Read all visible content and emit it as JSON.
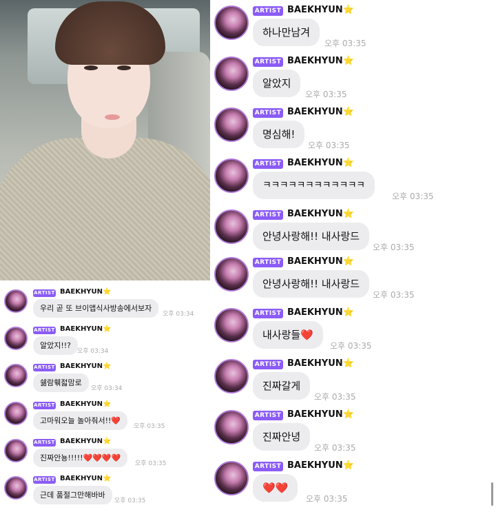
{
  "photo": {
    "alt": "selfie"
  },
  "artist_badge": "ARTIST",
  "artist_name": "BAEKHYUN",
  "star": "⭐",
  "left_messages": [
    {
      "text": "우리 곧 또 브이앱식사방송에서보자",
      "time": "오후 03:34"
    },
    {
      "text": "알았지!!?",
      "time": "오후 03:34"
    },
    {
      "text": "쉚람훾젋맘로",
      "time": "오후 03:34"
    },
    {
      "text": "고마워오늘 놀아줘서!!",
      "heart": "❤️",
      "time": "오후 03:35"
    },
    {
      "text": "진짜안뇽!!!!!",
      "heart": "❤️❤️❤️❤️",
      "time": "오후 03:35"
    },
    {
      "text": "근데 품절그만해바바",
      "time": "오후 03:35"
    }
  ],
  "right_messages": [
    {
      "text": "하나만남겨",
      "time": "오후 03:35"
    },
    {
      "text": "알았지",
      "time": "오후 03:35"
    },
    {
      "text": "명심해!",
      "time": "오후 03:35"
    },
    {
      "text": "ㅋㅋㅋㅋㅋㅋㅋㅋㅋㅋㅋㅋ",
      "time": "오후 03:35"
    },
    {
      "text": "안녕사랑해!! 내사랑드",
      "time": "오후 03:35"
    },
    {
      "text": "안녕사랑해!! 내사랑드",
      "time": "오후 03:35"
    },
    {
      "text": "내사랑들",
      "heart": "❤️",
      "time": "오후 03:35"
    },
    {
      "text": "진짜갈게",
      "time": "오후 03:35"
    },
    {
      "text": "진짜안녕",
      "time": "오후 03:35"
    },
    {
      "text": "",
      "heart": "❤️❤️",
      "time": "오후 03:35"
    }
  ]
}
